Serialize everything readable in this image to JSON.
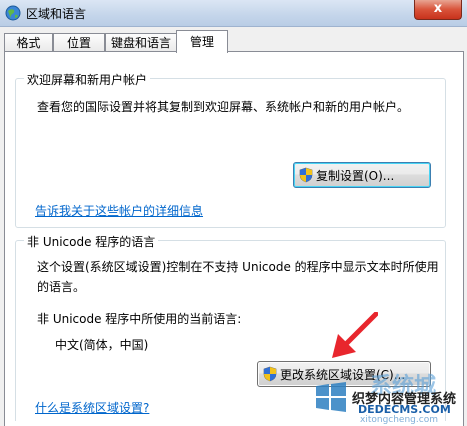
{
  "window": {
    "title": "区域和语言",
    "close_symbol": "x"
  },
  "tabs": [
    {
      "label": "格式"
    },
    {
      "label": "位置"
    },
    {
      "label": "键盘和语言"
    },
    {
      "label": "管理"
    }
  ],
  "welcome_group": {
    "legend": "欢迎屏幕和新用户帐户",
    "description": "查看您的国际设置并将其复制到欢迎屏幕、系统帐户和新的用户帐户。",
    "copy_button": "复制设置(O)...",
    "info_link": "告诉我关于这些帐户的详细信息"
  },
  "unicode_group": {
    "legend": "非 Unicode 程序的语言",
    "description_line1": "这个设置(系统区域设置)控制在不支持 Unicode 的程序中显示文本时所使用",
    "description_line2": "的语言。",
    "current_label": "非 Unicode 程序中所使用的当前语言:",
    "current_value": "中文(简体，中国)",
    "change_button": "更改系统区域设置(C)...",
    "help_link": "什么是系统区域设置?"
  },
  "watermark": {
    "brand": "系统城",
    "site": "xitongcheng.com",
    "overlay_title": "织梦内容管理系统",
    "overlay_url": "DEDECMS.COM"
  },
  "colors": {
    "link": "#0066cc",
    "arrow": "#e8262d"
  }
}
